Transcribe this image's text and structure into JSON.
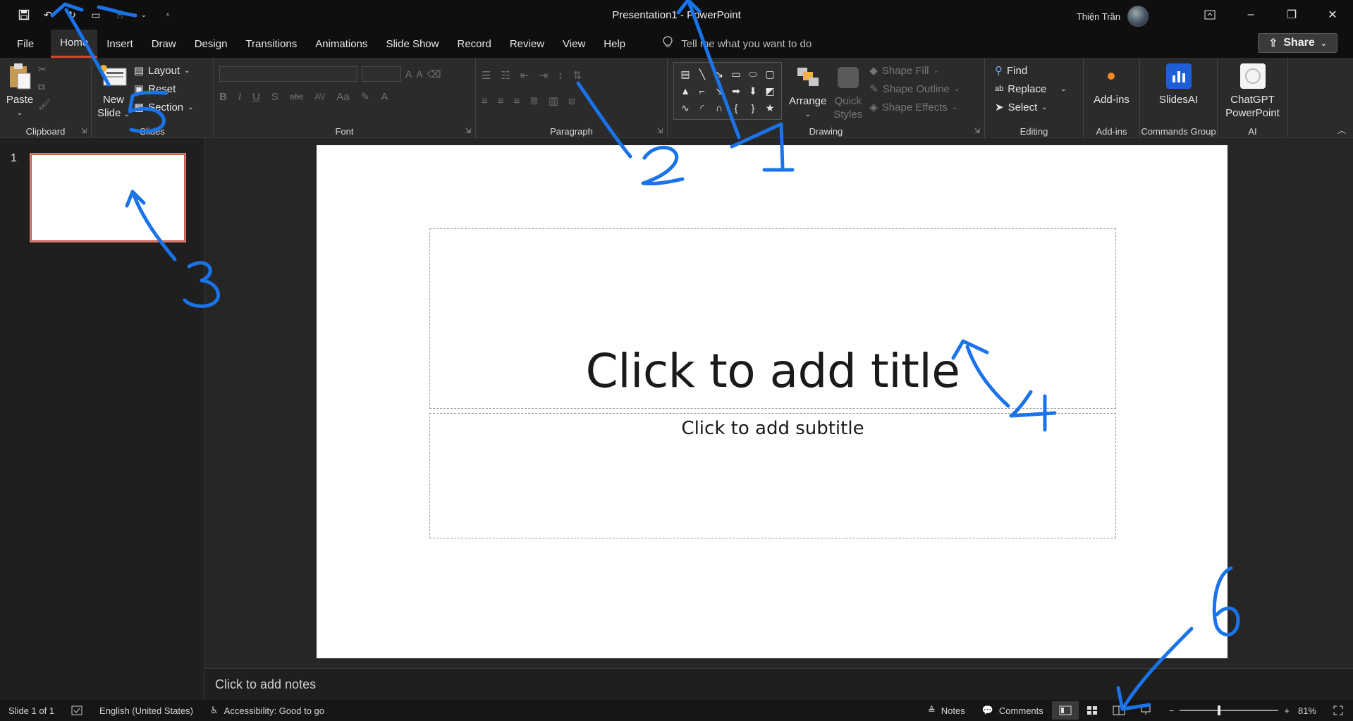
{
  "window": {
    "title": "Presentation1 - PowerPoint",
    "user_name": "Thiện Trần"
  },
  "menu": {
    "tabs": [
      "File",
      "Home",
      "Insert",
      "Draw",
      "Design",
      "Transitions",
      "Animations",
      "Slide Show",
      "Record",
      "Review",
      "View",
      "Help"
    ],
    "active_tab": "Home",
    "tell_me_placeholder": "Tell me what you want to do",
    "share_label": "Share"
  },
  "ribbon": {
    "clipboard": {
      "paste": "Paste",
      "label": "Clipboard"
    },
    "slides": {
      "new_slide_line1": "New",
      "new_slide_line2": "Slide",
      "layout": "Layout",
      "reset": "Reset",
      "section": "Section",
      "label": "Slides"
    },
    "font": {
      "label": "Font"
    },
    "paragraph": {
      "label": "Paragraph"
    },
    "drawing": {
      "arrange": "Arrange",
      "quick_styles_line1": "Quick",
      "quick_styles_line2": "Styles",
      "shape_fill": "Shape Fill",
      "shape_outline": "Shape Outline",
      "shape_effects": "Shape Effects",
      "label": "Drawing"
    },
    "editing": {
      "find": "Find",
      "replace": "Replace",
      "select": "Select",
      "label": "Editing"
    },
    "addins": {
      "button": "Add-ins",
      "label": "Add-ins"
    },
    "commands": {
      "button": "SlidesAI",
      "label": "Commands Group"
    },
    "ai": {
      "button_line1": "ChatGPT",
      "button_line2": "PowerPoint",
      "label": "AI"
    }
  },
  "thumbnails": {
    "slide_number": "1"
  },
  "slide": {
    "title_placeholder": "Click to add title",
    "subtitle_placeholder": "Click to add subtitle"
  },
  "notes": {
    "placeholder": "Click to add notes"
  },
  "status": {
    "slide_count": "Slide 1 of 1",
    "language": "English (United States)",
    "accessibility": "Accessibility: Good to go",
    "notes": "Notes",
    "comments": "Comments",
    "zoom": "81%",
    "zoom_level": 0.81
  },
  "annotations": {
    "color": "#1a73e8",
    "labels": [
      "1",
      "2",
      "3",
      "4",
      "5",
      "6"
    ]
  }
}
